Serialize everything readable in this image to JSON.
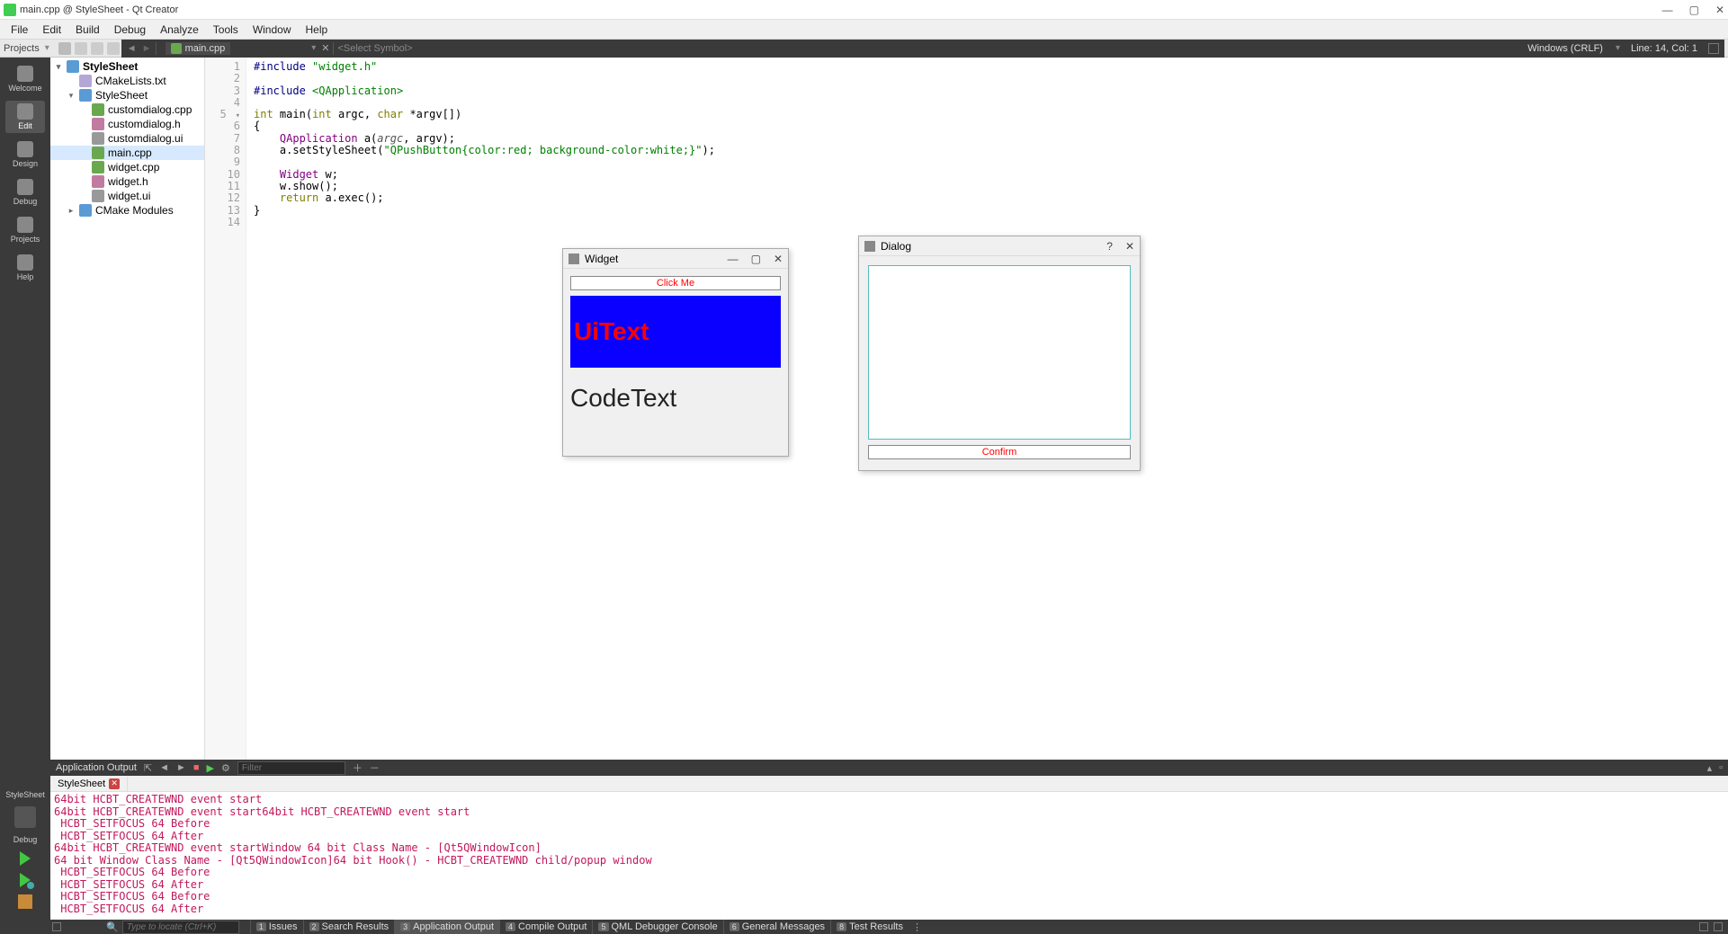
{
  "window": {
    "title": "main.cpp @ StyleSheet - Qt Creator",
    "controls": {
      "min": "—",
      "max": "▢",
      "close": "✕"
    }
  },
  "menu": [
    "File",
    "Edit",
    "Build",
    "Debug",
    "Analyze",
    "Tools",
    "Window",
    "Help"
  ],
  "toolbar": {
    "projects_label": "Projects",
    "current_file": "main.cpp",
    "symbol_placeholder": "<Select Symbol>",
    "encoding": "Windows (CRLF)",
    "cursor": "Line: 14, Col: 1"
  },
  "leftbar": {
    "modes": [
      {
        "label": "Welcome"
      },
      {
        "label": "Edit",
        "active": true
      },
      {
        "label": "Design"
      },
      {
        "label": "Debug"
      },
      {
        "label": "Projects"
      },
      {
        "label": "Help"
      }
    ],
    "kit_top": "StyleSheet",
    "kit_bottom": "Debug"
  },
  "tree": {
    "root": "StyleSheet",
    "items": [
      {
        "label": "CMakeLists.txt",
        "icon": "ico-cmake",
        "depth": 1
      },
      {
        "label": "StyleSheet",
        "icon": "ico-folder",
        "depth": 1,
        "exp": "▾",
        "bold": false
      },
      {
        "label": "customdialog.cpp",
        "icon": "ico-cpp",
        "depth": 2
      },
      {
        "label": "customdialog.h",
        "icon": "ico-h",
        "depth": 2
      },
      {
        "label": "customdialog.ui",
        "icon": "ico-ui",
        "depth": 2
      },
      {
        "label": "main.cpp",
        "icon": "ico-cpp",
        "depth": 2,
        "sel": true
      },
      {
        "label": "widget.cpp",
        "icon": "ico-cpp",
        "depth": 2
      },
      {
        "label": "widget.h",
        "icon": "ico-h",
        "depth": 2
      },
      {
        "label": "widget.ui",
        "icon": "ico-ui",
        "depth": 2
      },
      {
        "label": "CMake Modules",
        "icon": "ico-folder",
        "depth": 1,
        "exp": "▸"
      }
    ]
  },
  "code": {
    "lines": [
      {
        "n": 1,
        "html": "<span class='pre'>#include</span> <span class='str'>\"widget.h\"</span>"
      },
      {
        "n": 2,
        "html": ""
      },
      {
        "n": 3,
        "html": "<span class='pre'>#include</span> <span class='str'>&lt;QApplication&gt;</span>"
      },
      {
        "n": 4,
        "html": ""
      },
      {
        "n": 5,
        "html": "<span class='kw'>int</span> <span>main</span>(<span class='kw'>int</span> argc, <span class='kw'>char</span> *argv[])",
        "fold": true
      },
      {
        "n": 6,
        "html": "{"
      },
      {
        "n": 7,
        "html": "    <span class='typ'>QApplication</span> a(<span class='var'>argc</span>, argv);"
      },
      {
        "n": 8,
        "html": "    a.setStyleSheet(<span class='str'>\"QPushButton{color:red; background-color:white;}\"</span>);"
      },
      {
        "n": 9,
        "html": ""
      },
      {
        "n": 10,
        "html": "    <span class='typ'>Widget</span> w;"
      },
      {
        "n": 11,
        "html": "    w.show();"
      },
      {
        "n": 12,
        "html": "    <span class='kw'>return</span> a.exec();"
      },
      {
        "n": 13,
        "html": "}"
      },
      {
        "n": 14,
        "html": ""
      }
    ]
  },
  "output": {
    "title": "Application Output",
    "filter_placeholder": "Filter",
    "tab": "StyleSheet",
    "lines": [
      "64bit HCBT_CREATEWND event start",
      "64bit HCBT_CREATEWND event start64bit HCBT_CREATEWND event start",
      " HCBT_SETFOCUS 64 Before",
      " HCBT_SETFOCUS 64 After",
      "64bit HCBT_CREATEWND event startWindow 64 bit Class Name - [Qt5QWindowIcon]",
      "64 bit Window Class Name - [Qt5QWindowIcon]64 bit Hook() - HCBT_CREATEWND child/popup window",
      " HCBT_SETFOCUS 64 Before",
      " HCBT_SETFOCUS 64 After",
      " HCBT_SETFOCUS 64 Before",
      " HCBT_SETFOCUS 64 After"
    ]
  },
  "statusbar": {
    "locator_placeholder": "Type to locate (Ctrl+K)",
    "buttons": [
      {
        "n": "1",
        "label": "Issues"
      },
      {
        "n": "2",
        "label": "Search Results"
      },
      {
        "n": "3",
        "label": "Application Output",
        "active": true
      },
      {
        "n": "4",
        "label": "Compile Output"
      },
      {
        "n": "5",
        "label": "QML Debugger Console"
      },
      {
        "n": "6",
        "label": "General Messages"
      },
      {
        "n": "8",
        "label": "Test Results"
      }
    ]
  },
  "widget_window": {
    "title": "Widget",
    "button": "Click Me",
    "uitext": "UiText",
    "codetext": "CodeText"
  },
  "dialog_window": {
    "title": "Dialog",
    "confirm": "Confirm"
  }
}
